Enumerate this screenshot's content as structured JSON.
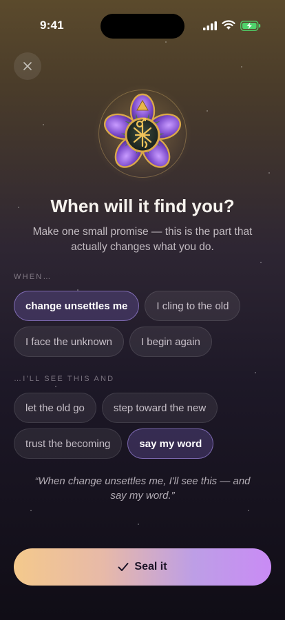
{
  "status_bar": {
    "time": "9:41"
  },
  "header": {
    "close_icon": "close-icon"
  },
  "emblem": {
    "icon": "star-flower-sigil-emblem"
  },
  "title": "When will it find you?",
  "subtitle": "Make one small promise — this is the part that actually changes what you do.",
  "when_section": {
    "label": "WHEN…",
    "options": [
      {
        "label": "change unsettles me",
        "selected": true
      },
      {
        "label": "I cling to the old",
        "selected": false
      },
      {
        "label": "I face the unknown",
        "selected": false
      },
      {
        "label": "I begin again",
        "selected": false
      }
    ]
  },
  "then_section": {
    "label": "…I'LL SEE THIS AND",
    "options": [
      {
        "label": "let the old go",
        "selected": false
      },
      {
        "label": "step toward the new",
        "selected": false
      },
      {
        "label": "trust the becoming",
        "selected": false
      },
      {
        "label": "say my word",
        "selected": true
      }
    ]
  },
  "preview_quote": "“When change unsettles me, I'll see this — and say my word.”",
  "seal_button": {
    "label": "Seal it",
    "icon": "check-icon"
  },
  "colors": {
    "accent_selected": "#7a5fc0",
    "button_start": "#f4c98c",
    "button_end": "#c98bf5"
  }
}
